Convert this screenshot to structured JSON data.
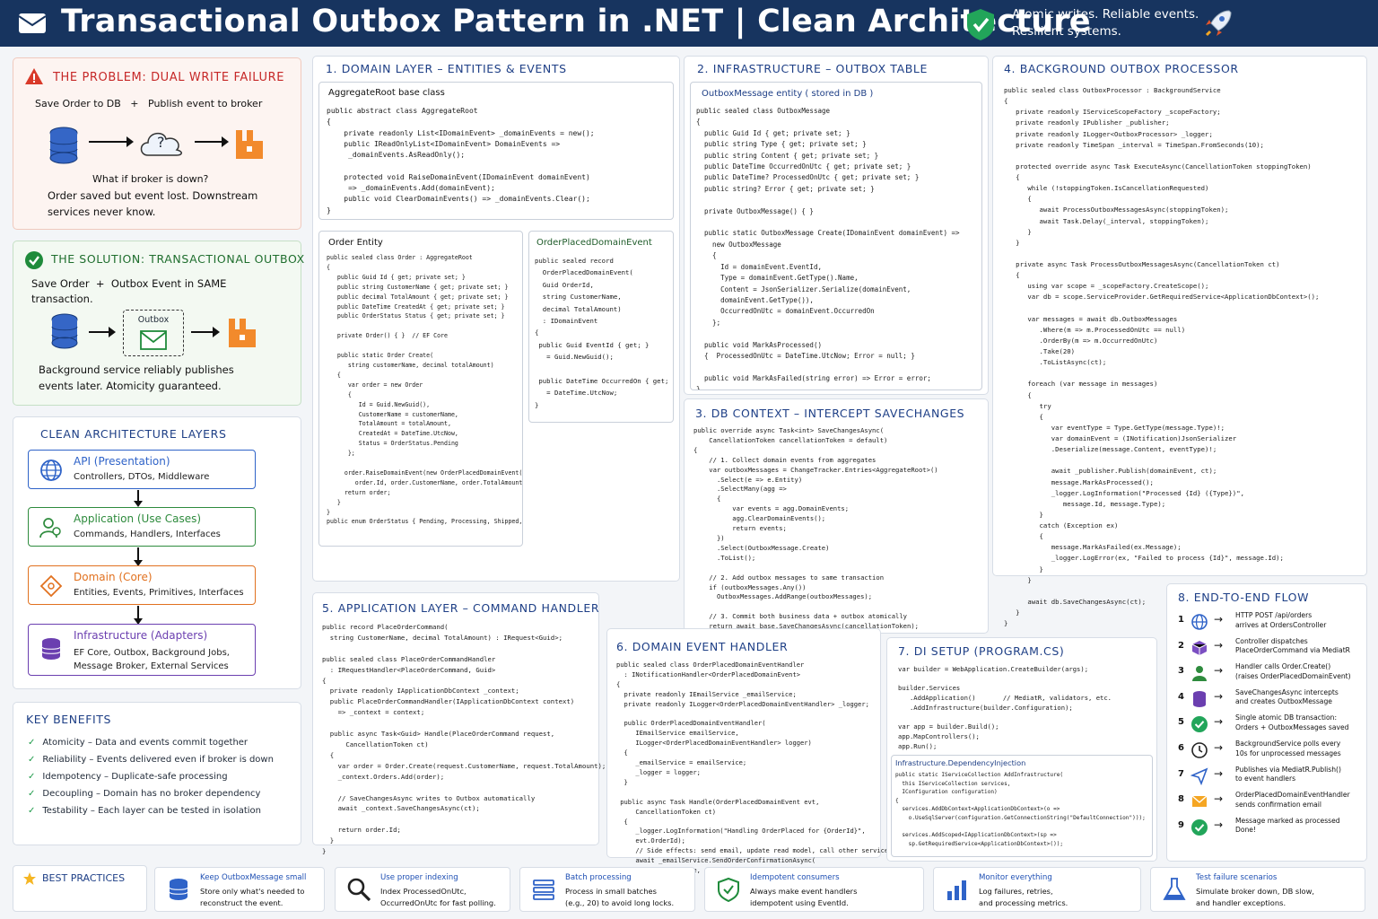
{
  "header": {
    "title": "Transactional Outbox Pattern in .NET | Clean Architecture",
    "tagline_1": "Atomic writes. Reliable events.",
    "tagline_2": "Resilient systems."
  },
  "problem": {
    "title": "THE PROBLEM: DUAL WRITE FAILURE",
    "subtitle": "Save Order to DB   +   Publish event to broker",
    "question": "What if broker is down?",
    "line1": "Order saved but event lost. Downstream",
    "line2": "services never know.",
    "q_mark": "?"
  },
  "solution": {
    "title": "THE SOLUTION: TRANSACTIONAL OUTBOX",
    "line1": "Save Order  +  Outbox Event in SAME",
    "line2": "transaction.",
    "outbox_label": "Outbox",
    "desc1": "Background service reliably publishes",
    "desc2": "events later. Atomicity guaranteed."
  },
  "layers": {
    "title": "CLEAN ARCHITECTURE LAYERS",
    "items": [
      {
        "name": "API (Presentation)",
        "desc": "Controllers, DTOs, Middleware",
        "color": "#2f63c8",
        "icon": "globe-icon"
      },
      {
        "name": "Application (Use Cases)",
        "desc": "Commands, Handlers, Interfaces",
        "color": "#2e8b3d",
        "icon": "users-icon"
      },
      {
        "name": "Domain (Core)",
        "desc": "Entities, Events, Primitives, Interfaces",
        "color": "#e1711f",
        "icon": "diamond-icon"
      },
      {
        "name": "Infrastructure (Adapters)",
        "desc": "EF Core, Outbox, Background Jobs,\nMessage Broker, External Services",
        "color": "#6b3fb0",
        "icon": "database-icon"
      }
    ]
  },
  "benefits": {
    "title": "KEY BENEFITS",
    "items": [
      {
        "name": "Atomicity",
        "desc": " – Data and events commit together"
      },
      {
        "name": "Reliability",
        "desc": " – Events delivered even if broker is down"
      },
      {
        "name": "Idempotency",
        "desc": " – Duplicate-safe processing"
      },
      {
        "name": "Decoupling",
        "desc": " – Domain has no broker dependency"
      },
      {
        "name": "Testability",
        "desc": " – Each layer can be tested in isolation"
      }
    ]
  },
  "domain_layer": {
    "title": "1.  DOMAIN LAYER  –  ENTITIES  &  EVENTS",
    "aggregate_head": "AggregateRoot base class",
    "aggregate_code": "public abstract class AggregateRoot\n{\n    private readonly List<IDomainEvent> _domainEvents = new();\n    public IReadOnlyList<IDomainEvent> DomainEvents =>\n     _domainEvents.AsReadOnly();\n\n    protected void RaiseDomainEvent(IDomainEvent domainEvent)\n     => _domainEvents.Add(domainEvent);\n    public void ClearDomainEvents() => _domainEvents.Clear();\n}",
    "order_head": "Order Entity",
    "order_code": "public sealed class Order : AggregateRoot\n{\n   public Guid Id { get; private set; }\n   public string CustomerName { get; private set; }\n   public decimal TotalAmount { get; private set; }\n   public DateTime CreatedAt { get; private set; }\n   public OrderStatus Status { get; private set; }\n\n   private Order() { }  // EF Core\n\n   public static Order Create(\n      string customerName, decimal totalAmount)\n   {\n      var order = new Order\n      {\n         Id = Guid.NewGuid(),\n         CustomerName = customerName,\n         TotalAmount = totalAmount,\n         CreatedAt = DateTime.UtcNow,\n         Status = OrderStatus.Pending\n      };\n\n     order.RaiseDomainEvent(new OrderPlacedDomainEvent(\n        order.Id, order.CustomerName, order.TotalAmount));\n     return order;\n   }\n}\npublic enum OrderStatus { Pending, Processing, Shipped, Delivered }",
    "event_head": "OrderPlacedDomainEvent",
    "event_code": "public sealed record\n  OrderPlacedDomainEvent(\n  Guid OrderId,\n  string CustomerName,\n  decimal TotalAmount)\n  : IDomainEvent\n{\n public Guid EventId { get; }\n   = Guid.NewGuid();\n\n public DateTime OccurredOn { get; }\n   = DateTime.UtcNow;\n}"
  },
  "infra": {
    "title": "2.  INFRASTRUCTURE  –  OUTBOX  TABLE",
    "entity_head": "OutboxMessage entity ( stored in DB )",
    "code": "public sealed class OutboxMessage\n{\n  public Guid Id { get; private set; }\n  public string Type { get; private set; }\n  public string Content { get; private set; }\n  public DateTime OccurredOnUtc { get; private set; }\n  public DateTime? ProcessedOnUtc { get; private set; }\n  public string? Error { get; private set; }\n\n  private OutboxMessage() { }\n\n  public static OutboxMessage Create(IDomainEvent domainEvent) =>\n    new OutboxMessage\n    {\n      Id = domainEvent.EventId,\n      Type = domainEvent.GetType().Name,\n      Content = JsonSerializer.Serialize(domainEvent,\n      domainEvent.GetType()),\n      OccurredOnUtc = domainEvent.OccurredOn\n    };\n\n  public void MarkAsProcessed()\n  {  ProcessedOnUtc = DateTime.UtcNow; Error = null; }\n\n  public void MarkAsFailed(string error) => Error = error;\n}"
  },
  "dbcontext": {
    "title": "3.  DB CONTEXT  –  INTERCEPT SAVECHANGES",
    "code": "public override async Task<int> SaveChangesAsync(\n    CancellationToken cancellationToken = default)\n{\n    // 1. Collect domain events from aggregates\n    var outboxMessages = ChangeTracker.Entries<AggregateRoot>()\n      .Select(e => e.Entity)\n      .SelectMany(agg =>\n      {\n          var events = agg.DomainEvents;\n          agg.ClearDomainEvents();\n          return events;\n      })\n      .Select(OutboxMessage.Create)\n      .ToList();\n\n    // 2. Add outbox messages to same transaction\n    if (outboxMessages.Any())\n      OutboxMessages.AddRange(outboxMessages);\n\n    // 3. Commit both business data + outbox atomically\n    return await base.SaveChangesAsync(cancellationToken);\n}"
  },
  "processor": {
    "title": "4.  BACKGROUND OUTBOX PROCESSOR",
    "code": "public sealed class OutboxProcessor : BackgroundService\n{\n   private readonly IServiceScopeFactory _scopeFactory;\n   private readonly IPublisher _publisher;\n   private readonly ILogger<OutboxProcessor> _logger;\n   private readonly TimeSpan _interval = TimeSpan.FromSeconds(10);\n\n   protected override async Task ExecuteAsync(CancellationToken stoppingToken)\n   {\n      while (!stoppingToken.IsCancellationRequested)\n      {\n         await ProcessOutboxMessagesAsync(stoppingToken);\n         await Task.Delay(_interval, stoppingToken);\n      }\n   }\n\n   private async Task ProcessOutboxMessagesAsync(CancellationToken ct)\n   {\n      using var scope = _scopeFactory.CreateScope();\n      var db = scope.ServiceProvider.GetRequiredService<ApplicationDbContext>();\n\n      var messages = await db.OutboxMessages\n         .Where(m => m.ProcessedOnUtc == null)\n         .OrderBy(m => m.OccurredOnUtc)\n         .Take(20)\n         .ToListAsync(ct);\n\n      foreach (var message in messages)\n      {\n         try\n         {\n            var eventType = Type.GetType(message.Type)!;\n            var domainEvent = (INotification)JsonSerializer\n            .Deserialize(message.Content, eventType)!;\n\n            await _publisher.Publish(domainEvent, ct);\n            message.MarkAsProcessed();\n            _logger.LogInformation(\"Processed {Id} ({Type})\",\n               message.Id, message.Type);\n         }\n         catch (Exception ex)\n         {\n            message.MarkAsFailed(ex.Message);\n            _logger.LogError(ex, \"Failed to process {Id}\", message.Id);\n         }\n      }\n\n      await db.SaveChangesAsync(ct);\n   }\n}"
  },
  "app_layer": {
    "title": "5.  APPLICATION LAYER  –  COMMAND HANDLER",
    "code": "public record PlaceOrderCommand(\n  string CustomerName, decimal TotalAmount) : IRequest<Guid>;\n\npublic sealed class PlaceOrderCommandHandler\n  : IRequestHandler<PlaceOrderCommand, Guid>\n{\n  private readonly IApplicationDbContext _context;\n  public PlaceOrderCommandHandler(IApplicationDbContext context)\n    => _context = context;\n\n  public async Task<Guid> Handle(PlaceOrderCommand request,\n      CancellationToken ct)\n  {\n    var order = Order.Create(request.CustomerName, request.TotalAmount);\n    _context.Orders.Add(order);\n\n    // SaveChangesAsync writes to Outbox automatically\n    await _context.SaveChangesAsync(ct);\n\n    return order.Id;\n  }\n}"
  },
  "event_handler": {
    "title": "6.  DOMAIN EVENT HANDLER",
    "code": "public sealed class OrderPlacedDomainEventHandler\n  : INotificationHandler<OrderPlacedDomainEvent>\n{\n  private readonly IEmailService _emailService;\n  private readonly ILogger<OrderPlacedDomainEventHandler> _logger;\n\n  public OrderPlacedDomainEventHandler(\n     IEmailService emailService,\n     ILogger<OrderPlacedDomainEventHandler> logger)\n  {\n     _emailService = emailService;\n     _logger = logger;\n  }\n\n public async Task Handle(OrderPlacedDomainEvent evt,\n     CancellationToken ct)\n  {\n     _logger.LogInformation(\"Handling OrderPlaced for {OrderId}\",\n     evt.OrderId);\n     // Side effects: send email, update read model, call other services\n     await _emailService.SendOrderConfirmationAsync(\n     evt.CustomerName, evt.OrderId, evt.TotalAmount);\n  }\n}"
  },
  "di": {
    "title": "7.  DI SETUP  (PROGRAM.CS)",
    "code": "var builder = WebApplication.CreateBuilder(args);\n\nbuilder.Services\n   .AddApplication()       // MediatR, validators, etc.\n   .AddInfrastructure(builder.Configuration);\n\nvar app = builder.Build();\napp.MapControllers();\napp.Run();",
    "sub_head": "Infrastructure.DependencyInjection",
    "sub_code": "public static IServiceCollection AddInfrastructure(\n  this IServiceCollection services,\n  IConfiguration configuration)\n{\n  services.AddDbContext<ApplicationDbContext>(o =>\n    o.UseSqlServer(configuration.GetConnectionString(\"DefaultConnection\")));\n\n  services.AddScoped<IApplicationDbContext>(sp =>\n    sp.GetRequiredService<ApplicationDbContext>());\n\n  services.AddHostedService<OutboxProcessor>();\n  return services;\n}"
  },
  "flow": {
    "title": "8.  END-TO-END FLOW",
    "steps": [
      {
        "n": "1",
        "icon": "globe-icon",
        "l1": "HTTP POST /api/orders",
        "l2": "arrives at OrdersController"
      },
      {
        "n": "2",
        "icon": "cube-icon",
        "l1": "Controller dispatches",
        "l2": "PlaceOrderCommand via MediatR"
      },
      {
        "n": "3",
        "icon": "user-icon",
        "l1": "Handler calls Order.Create()",
        "l2": "(raises OrderPlacedDomainEvent)"
      },
      {
        "n": "4",
        "icon": "database-icon",
        "l1": "SaveChangesAsync intercepts",
        "l2": "and creates OutboxMessage"
      },
      {
        "n": "5",
        "icon": "check-icon",
        "l1": "Single atomic DB transaction:",
        "l2": "Orders + OutboxMessages saved"
      },
      {
        "n": "6",
        "icon": "clock-icon",
        "l1": "BackgroundService polls every",
        "l2": "10s for unprocessed messages"
      },
      {
        "n": "7",
        "icon": "send-icon",
        "l1": "Publishes via MediatR.Publish()",
        "l2": "to event handlers"
      },
      {
        "n": "8",
        "icon": "mail-icon",
        "l1": "OrderPlacedDomainEventHandler",
        "l2": "sends confirmation email"
      },
      {
        "n": "9",
        "icon": "check-icon",
        "l1": "Message marked as processed",
        "l2": "Done!"
      }
    ]
  },
  "practices": {
    "title": "BEST PRACTICES",
    "items": [
      {
        "t": "Keep OutboxMessage small",
        "d1": "Store only what's needed to",
        "d2": "reconstruct the event.",
        "icon": "database-icon"
      },
      {
        "t": "Use proper indexing",
        "d1": "Index ProcessedOnUtc,",
        "d2": "OccurredOnUtc for fast polling.",
        "icon": "search-icon"
      },
      {
        "t": "Batch processing",
        "d1": "Process in small batches",
        "d2": "(e.g., 20) to avoid long locks.",
        "icon": "list-icon"
      },
      {
        "t": "Idempotent consumers",
        "d1": "Always make event handlers",
        "d2": "idempotent using EventId.",
        "icon": "shield-icon"
      },
      {
        "t": "Monitor everything",
        "d1": "Log failures, retries,",
        "d2": "and processing metrics.",
        "icon": "bar-chart-icon"
      },
      {
        "t": "Test failure scenarios",
        "d1": "Simulate broker down, DB slow,",
        "d2": "and handler exceptions.",
        "icon": "flask-icon"
      }
    ]
  }
}
